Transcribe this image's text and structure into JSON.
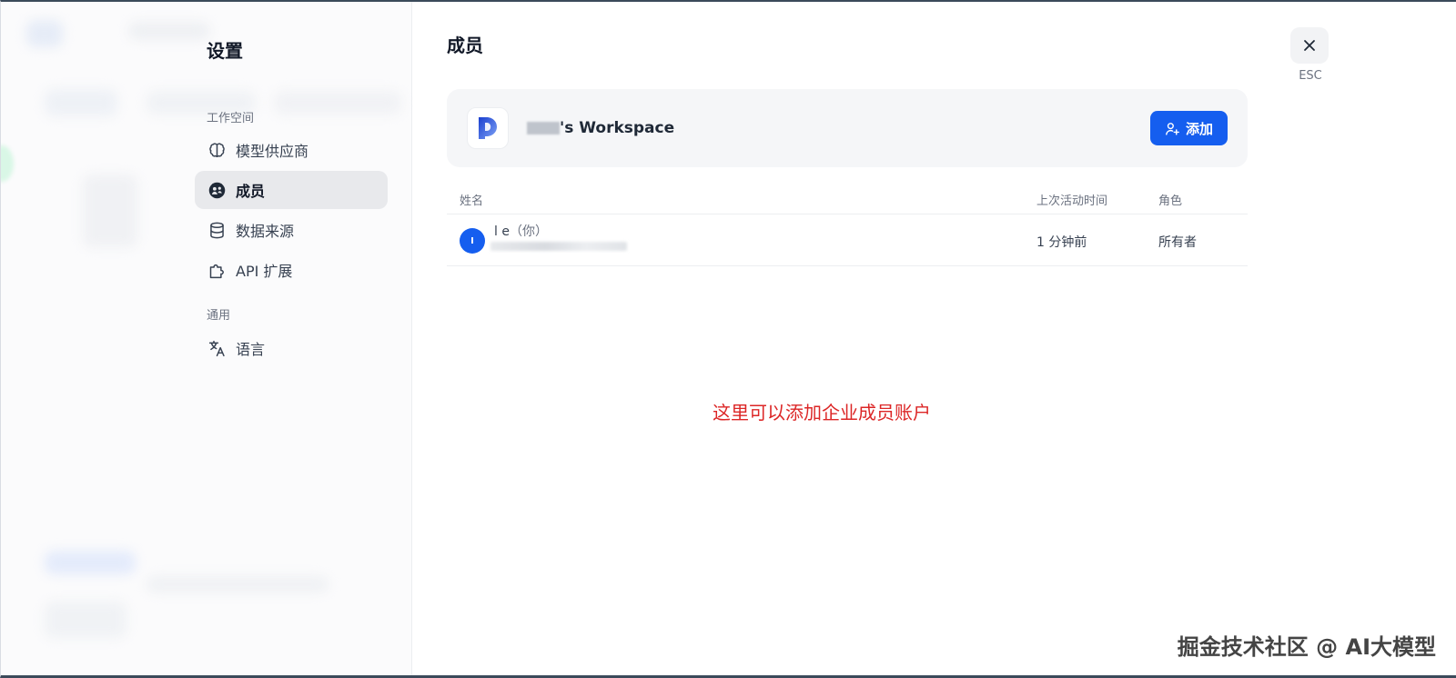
{
  "sidebar": {
    "title": "设置",
    "sections": [
      {
        "label": "工作空间"
      },
      {
        "label": "通用"
      }
    ],
    "items": [
      {
        "label": "模型供应商",
        "icon": "brain-icon"
      },
      {
        "label": "成员",
        "icon": "members-icon",
        "active": true
      },
      {
        "label": "数据来源",
        "icon": "database-icon"
      },
      {
        "label": "API 扩展",
        "icon": "puzzle-icon"
      },
      {
        "label": "语言",
        "icon": "translate-icon"
      }
    ]
  },
  "main": {
    "title": "成员",
    "workspace": {
      "name_suffix": "'s Workspace",
      "add_label": "添加"
    },
    "table": {
      "headers": [
        "姓名",
        "上次活动时间",
        "角色"
      ],
      "rows": [
        {
          "avatar_letter": "I",
          "name": "l e",
          "you_tag": "（你）",
          "last_active": "1 分钟前",
          "role": "所有者"
        }
      ]
    },
    "annotation": "这里可以添加企业成员账户"
  },
  "close": {
    "esc_label": "ESC"
  },
  "watermark": "掘金技术社区 @ AI大模型",
  "colors": {
    "primary": "#155eef",
    "annotation": "#dc2626",
    "active_bg": "#e8e9ec"
  }
}
